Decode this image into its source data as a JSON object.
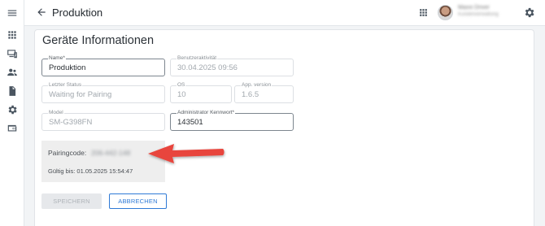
{
  "header": {
    "title": "Produktion",
    "user_name": "Maxxi Driver",
    "user_org": "Kundenverwaltung"
  },
  "card": {
    "title": "Geräte Informationen",
    "fields": {
      "name": {
        "label": "Name*",
        "value": "Produktion"
      },
      "activity": {
        "label": "Benutzeraktivität",
        "value": "30.04.2025 09:56"
      },
      "status": {
        "label": "Letzter Status",
        "value": "Waiting for Pairing"
      },
      "os": {
        "label": "OS",
        "value": "10"
      },
      "app_version": {
        "label": "App. version",
        "value": "1.6.5"
      },
      "model": {
        "label": "Model",
        "value": "SM-G398FN"
      },
      "admin_password": {
        "label": "Administrator Kennwort*",
        "value": "143501"
      }
    },
    "pairing": {
      "label": "Pairingcode:",
      "code": "206-442-148",
      "valid_until": "Gültig bis: 01.05.2025 15:54:47"
    },
    "buttons": {
      "save": "SPEICHERN",
      "cancel": "ABBRECHEN"
    }
  },
  "icons": {
    "rail": [
      "menu-icon",
      "grid-icon",
      "devices-icon",
      "users-icon",
      "document-icon",
      "settings-icon",
      "wallet-icon"
    ],
    "arrow_color": "#e8453c",
    "accent": "#2f7ad6"
  }
}
